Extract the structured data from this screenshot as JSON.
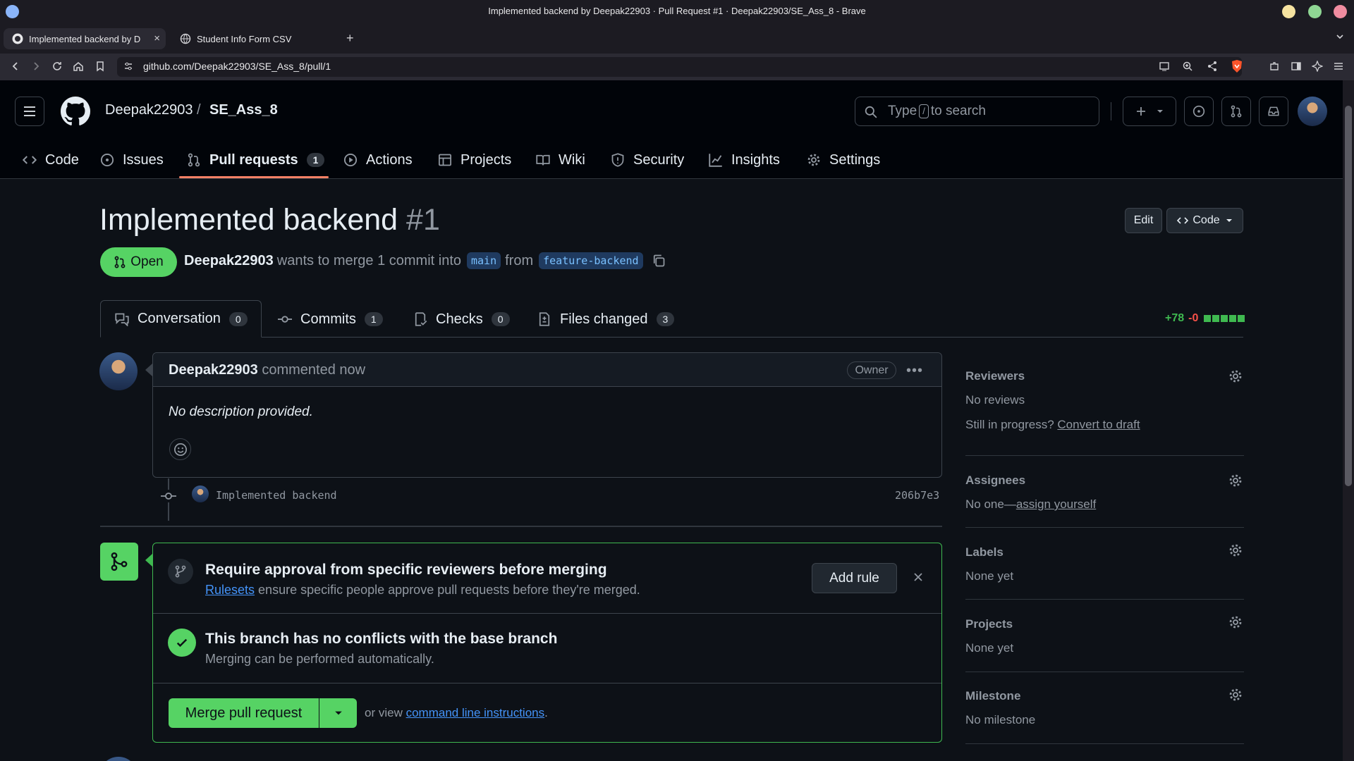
{
  "window": {
    "title": "Implemented backend by Deepak22903 · Pull Request #1 · Deepak22903/SE_Ass_8 - Brave"
  },
  "browser": {
    "tabs": [
      {
        "label": "Implemented backend by D"
      },
      {
        "label": "Student Info Form CSV"
      }
    ],
    "url": "github.com/Deepak22903/SE_Ass_8/pull/1"
  },
  "header": {
    "owner": "Deepak22903",
    "separator": "/",
    "repo": "SE_Ass_8",
    "search_prefix": "Type",
    "search_key": "/",
    "search_suffix": "to search"
  },
  "repo_nav": [
    {
      "label": "Code"
    },
    {
      "label": "Issues"
    },
    {
      "label": "Pull requests",
      "count": "1"
    },
    {
      "label": "Actions"
    },
    {
      "label": "Projects"
    },
    {
      "label": "Wiki"
    },
    {
      "label": "Security"
    },
    {
      "label": "Insights"
    },
    {
      "label": "Settings"
    }
  ],
  "pr": {
    "title": "Implemented backend",
    "number": "#1",
    "edit_label": "Edit",
    "code_label": "Code",
    "state": "Open",
    "author": "Deepak22903",
    "merge_text": "wants to merge 1 commit into",
    "base": "main",
    "from_text": "from",
    "head": "feature-backend"
  },
  "pr_tabs": [
    {
      "label": "Conversation",
      "count": "0"
    },
    {
      "label": "Commits",
      "count": "1"
    },
    {
      "label": "Checks",
      "count": "0"
    },
    {
      "label": "Files changed",
      "count": "3"
    }
  ],
  "diffstat": {
    "added": "+78",
    "removed": "-0",
    "blocks_green": 5,
    "colors": {
      "added": "#3fb950",
      "removed": "#f85149"
    }
  },
  "comment": {
    "author": "Deepak22903",
    "action": "commented now",
    "role": "Owner",
    "body": "No description provided."
  },
  "commit": {
    "message": "Implemented backend",
    "sha": "206b7e3"
  },
  "merge": {
    "ruleset_title": "Require approval from specific reviewers before merging",
    "ruleset_link": "Rulesets",
    "ruleset_text": "ensure specific people approve pull requests before they're merged.",
    "add_rule_label": "Add rule",
    "status_title": "This branch has no conflicts with the base branch",
    "status_sub": "Merging can be performed automatically.",
    "merge_button": "Merge pull request",
    "or_view": "or view",
    "cli_link": "command line instructions",
    "period": "."
  },
  "sidebar": {
    "reviewers": {
      "label": "Reviewers",
      "value": "No reviews",
      "draft_prefix": "Still in progress?",
      "draft_link": "Convert to draft"
    },
    "assignees": {
      "label": "Assignees",
      "value_prefix": "No one—",
      "value_link": "assign yourself"
    },
    "labels": {
      "label": "Labels",
      "value": "None yet"
    },
    "projects": {
      "label": "Projects",
      "value": "None yet"
    },
    "milestone": {
      "label": "Milestone",
      "value": "No milestone"
    }
  },
  "colors": {
    "accent_link": "#4493f8",
    "success": "#3fb950",
    "open_badge": "#56d364",
    "tab_underline": "#f78166"
  }
}
